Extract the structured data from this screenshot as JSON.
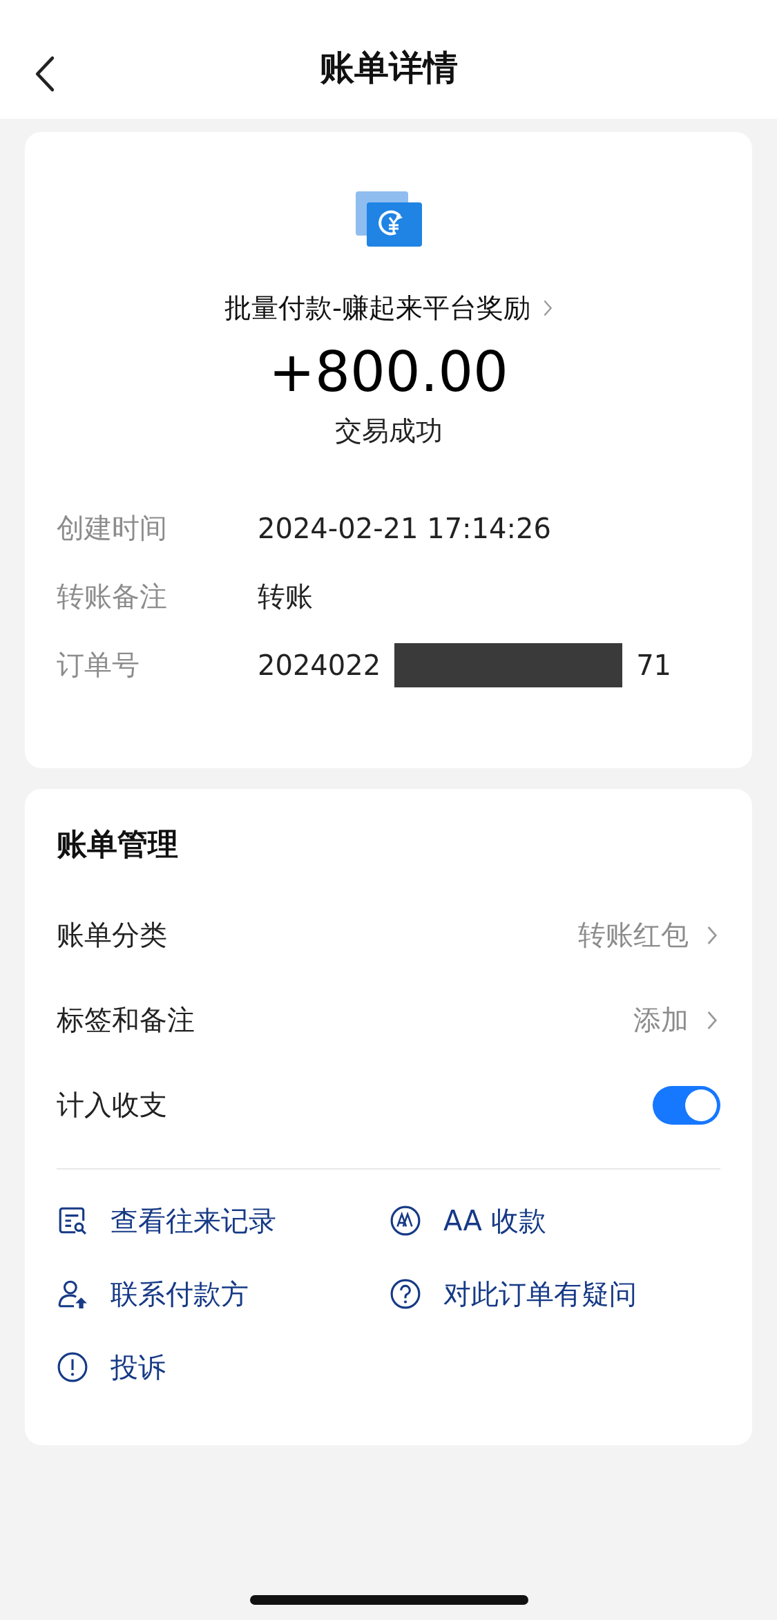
{
  "header": {
    "title": "账单详情"
  },
  "bill": {
    "title": "批量付款-赚起来平台奖励",
    "amount": "+800.00",
    "status": "交易成功",
    "details": [
      {
        "kind": "text",
        "label": "创建时间",
        "value": "2024-02-21 17:14:26"
      },
      {
        "kind": "text",
        "label": "转账备注",
        "value": "转账"
      },
      {
        "kind": "redacted",
        "label": "订单号",
        "value_start": "2024022",
        "value_end": "71"
      }
    ]
  },
  "management": {
    "title": "账单管理",
    "rows": [
      {
        "kind": "link",
        "label": "账单分类",
        "value": "转账红包"
      },
      {
        "kind": "link",
        "label": "标签和备注",
        "value": "添加"
      },
      {
        "kind": "toggle",
        "label": "计入收支",
        "on": true
      }
    ],
    "actions": [
      {
        "kind": "records",
        "label": "查看往来记录"
      },
      {
        "kind": "aa",
        "label": "AA 收款"
      },
      {
        "kind": "contact",
        "label": "联系付款方"
      },
      {
        "kind": "question",
        "label": "对此订单有疑问"
      },
      {
        "kind": "complaint",
        "label": "投诉"
      }
    ]
  }
}
